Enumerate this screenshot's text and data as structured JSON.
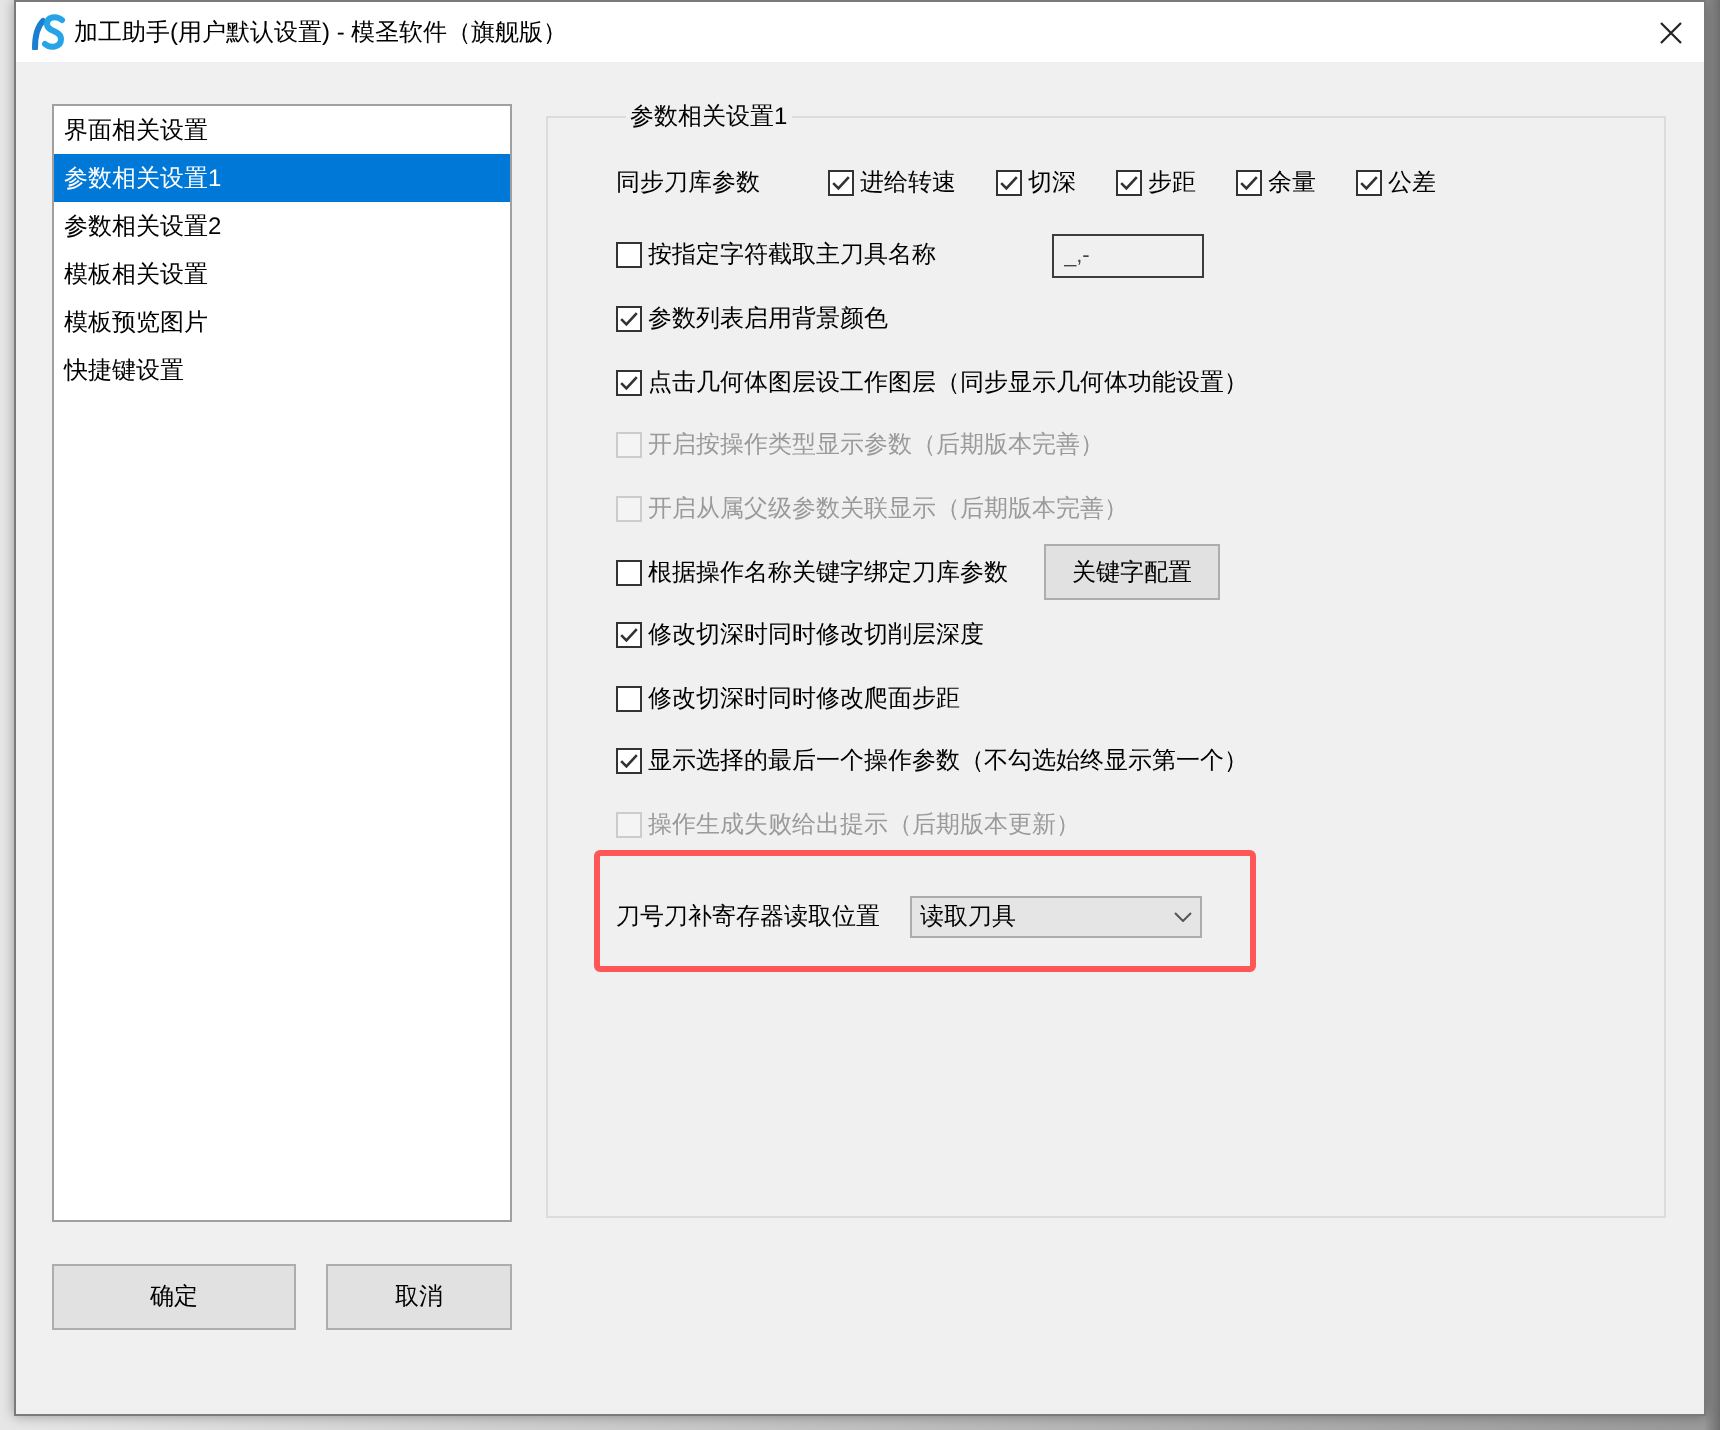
{
  "window": {
    "title": "加工助手(用户默认设置) - 模圣软件（旗舰版）"
  },
  "sidebar": {
    "items": [
      {
        "label": "界面相关设置",
        "selected": false
      },
      {
        "label": "参数相关设置1",
        "selected": true
      },
      {
        "label": "参数相关设置2",
        "selected": false
      },
      {
        "label": "模板相关设置",
        "selected": false
      },
      {
        "label": "模板预览图片",
        "selected": false
      },
      {
        "label": "快捷键设置",
        "selected": false
      }
    ]
  },
  "settings_group": {
    "title": "参数相关设置1",
    "sync": {
      "label": "同步刀库参数",
      "options": [
        {
          "label": "进给转速",
          "checked": true
        },
        {
          "label": "切深",
          "checked": true
        },
        {
          "label": "步距",
          "checked": true
        },
        {
          "label": "余量",
          "checked": true
        },
        {
          "label": "公差",
          "checked": true
        }
      ]
    },
    "options": [
      {
        "kind": "field",
        "label": "按指定字符截取主刀具名称",
        "checked": false,
        "disabled": false,
        "value": "_,-"
      },
      {
        "kind": "checkbox",
        "label": "参数列表启用背景颜色",
        "checked": true,
        "disabled": false
      },
      {
        "kind": "checkbox",
        "label": "点击几何体图层设工作图层（同步显示几何体功能设置）",
        "checked": true,
        "disabled": false
      },
      {
        "kind": "checkbox",
        "label": "开启按操作类型显示参数（后期版本完善）",
        "checked": false,
        "disabled": true
      },
      {
        "kind": "checkbox",
        "label": "开启从属父级参数关联显示（后期版本完善）",
        "checked": false,
        "disabled": true
      },
      {
        "kind": "button",
        "label": "根据操作名称关键字绑定刀库参数",
        "checked": false,
        "disabled": false,
        "button": "关键字配置"
      },
      {
        "kind": "checkbox",
        "label": "修改切深时同时修改切削层深度",
        "checked": true,
        "disabled": false
      },
      {
        "kind": "checkbox",
        "label": "修改切深时同时修改爬面步距",
        "checked": false,
        "disabled": false
      },
      {
        "kind": "checkbox",
        "label": "显示选择的最后一个操作参数（不勾选始终显示第一个）",
        "checked": true,
        "disabled": false
      },
      {
        "kind": "checkbox",
        "label": "操作生成失败给出提示（后期版本更新）",
        "checked": false,
        "disabled": true
      }
    ],
    "register_row": {
      "label": "刀号刀补寄存器读取位置",
      "highlighted": true,
      "dropdown": {
        "value": "读取刀具"
      }
    }
  },
  "buttons": [
    {
      "label": "确定"
    },
    {
      "label": "取消"
    }
  ]
}
